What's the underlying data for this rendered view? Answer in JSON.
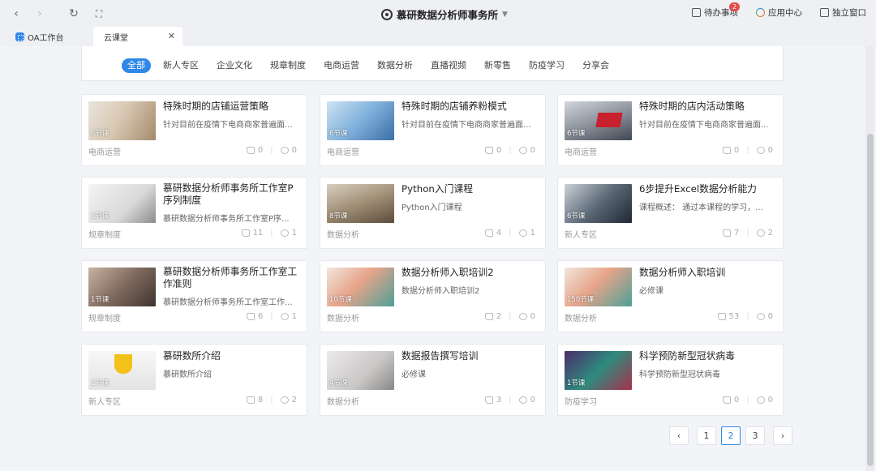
{
  "app": {
    "title": "慕研数据分析师事务所"
  },
  "top_right": {
    "todo_label": "待办事项",
    "todo_badge": "2",
    "app_center_label": "应用中心",
    "window_label": "独立窗口"
  },
  "tabs": [
    {
      "label": "OA工作台"
    },
    {
      "label": "云课堂"
    }
  ],
  "filters": [
    "全部",
    "新人专区",
    "企业文化",
    "规章制度",
    "电商运营",
    "数据分析",
    "直播视频",
    "新零售",
    "防疫学习",
    "分享会"
  ],
  "cards": [
    {
      "title": "特殊时期的店铺运营策略",
      "desc": "针对目前在疫情下电商商家普遍面...",
      "category": "电商运营",
      "lessons": "6节课",
      "likes": "0",
      "comments": "0"
    },
    {
      "title": "特殊时期的店铺养粉模式",
      "desc": "针对目前在疫情下电商商家普遍面...",
      "category": "电商运营",
      "lessons": "6节课",
      "likes": "0",
      "comments": "0"
    },
    {
      "title": "特殊时期的店内活动策略",
      "desc": "针对目前在疫情下电商商家普遍面...",
      "category": "电商运营",
      "lessons": "6节课",
      "likes": "0",
      "comments": "0"
    },
    {
      "title": "慕研数据分析师事务所工作室P序列制度",
      "desc": "慕研数据分析师事务所工作室P序...",
      "category": "规章制度",
      "lessons": "1节课",
      "likes": "11",
      "comments": "1"
    },
    {
      "title": "Python入门课程",
      "desc": "Python入门课程",
      "category": "数据分析",
      "lessons": "8节课",
      "likes": "4",
      "comments": "1"
    },
    {
      "title": "6步提升Excel数据分析能力",
      "desc": "课程概述： 通过本课程的学习，...",
      "category": "新人专区",
      "lessons": "6节课",
      "likes": "7",
      "comments": "2"
    },
    {
      "title": "慕研数据分析师事务所工作室工作准则",
      "desc": "慕研数据分析师事务所工作室工作...",
      "category": "规章制度",
      "lessons": "1节课",
      "likes": "6",
      "comments": "1"
    },
    {
      "title": "数据分析师入职培训2",
      "desc": "数据分析师入职培训2",
      "category": "数据分析",
      "lessons": "10节课",
      "likes": "2",
      "comments": "0"
    },
    {
      "title": "数据分析师入职培训",
      "desc": "必修课",
      "category": "数据分析",
      "lessons": "150节课",
      "likes": "53",
      "comments": "0"
    },
    {
      "title": "慕研数所介绍",
      "desc": "慕研数所介绍",
      "category": "新人专区",
      "lessons": "1节课",
      "likes": "8",
      "comments": "2"
    },
    {
      "title": "数据报告撰写培训",
      "desc": "必修课",
      "category": "数据分析",
      "lessons": "4节课",
      "likes": "3",
      "comments": "0"
    },
    {
      "title": "科学预防新型冠状病毒",
      "desc": "科学预防新型冠状病毒",
      "category": "防疫学习",
      "lessons": "1节课",
      "likes": "0",
      "comments": "0"
    }
  ],
  "pagination": {
    "prev": "‹",
    "pages": [
      "1",
      "2",
      "3"
    ],
    "next": "›",
    "current": "2"
  }
}
